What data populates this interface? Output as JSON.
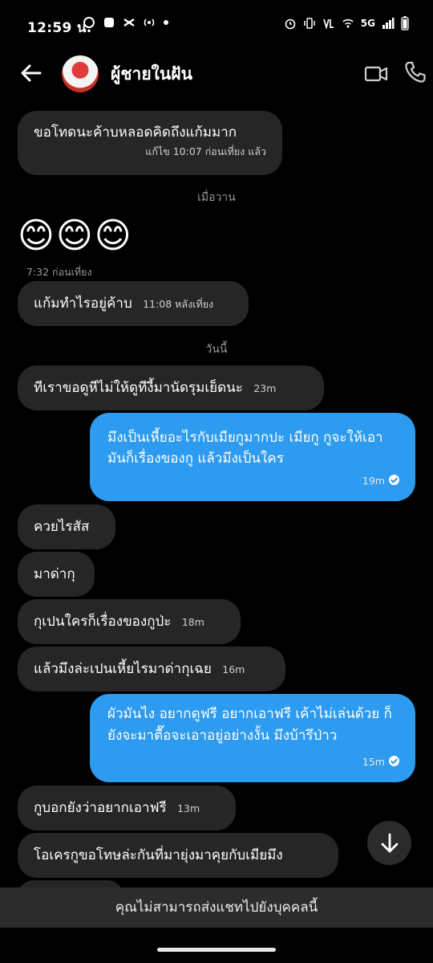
{
  "status_bar": {
    "time": "12:59 น.",
    "network": "5G"
  },
  "header": {
    "contact_name": "ผู้ชายในฝัน"
  },
  "separators": {
    "yesterday": "เมื่อวาน",
    "today": "วันนี้"
  },
  "messages": [
    {
      "dir": "in",
      "text": "ขอโทดนะค้าบหลอดคิดถึงแก้มมาก",
      "meta": "แก้ไข 10:07 ก่อนเที่ยง แล้ว"
    },
    {
      "dir": "in",
      "text": "😊😊😊",
      "meta": "7:32 ก่อนเที่ยง"
    },
    {
      "dir": "in",
      "text": "แก้มทำไรอยู่ค้าบ",
      "meta": "11:08 หลังเที่ยง"
    },
    {
      "dir": "in",
      "text": "ทีเราขอดูหีไม่ให้ดูทีงี้มานัดรุมเย็ดนะ",
      "meta": "23m"
    },
    {
      "dir": "out",
      "text": "มึงเป็นเหี้ยอะไรกับเมียกูมากปะ เมียกู กูจะให้เอามันก็เรื่องของกู แล้วมึงเป็นใคร",
      "meta": "19m"
    },
    {
      "dir": "in",
      "text": "ควยไรสัส",
      "meta": ""
    },
    {
      "dir": "in",
      "text": "มาด่ากุ",
      "meta": ""
    },
    {
      "dir": "in",
      "text": "กุเปนใครก็เรื่องของกูป่ะ",
      "meta": "18m"
    },
    {
      "dir": "in",
      "text": "แล้วมึงล่ะเปนเหี้ยไรมาด่ากุเฉย",
      "meta": "16m"
    },
    {
      "dir": "out",
      "text": "ผัวมันไง อยากดูฟรี อยากเอาฟรี เค้าไม่เล่นด้วย ก็ยังจะมาตื๊อจะเอาอยู่อย่างงั้น มึงบ้ารึป่าว",
      "meta": "15m"
    },
    {
      "dir": "in",
      "text": "กูบอกยังว่าอยากเอาฟรี",
      "meta": "13m"
    },
    {
      "dir": "in",
      "text": "โอเครกูขอโทษล่ะกันที่มายุ่งมาคุยกับเมียมึง",
      "meta": ""
    }
  ],
  "bottom_notice": "คุณไม่สามารถส่งแชทไปยังบุคคลนี้",
  "icons": [
    "arrow-left-icon",
    "video-call-icon",
    "phone-icon",
    "arrow-down-icon"
  ],
  "colors": {
    "outgoing": "#2d9bef",
    "incoming": "#262626",
    "background": "#000000"
  }
}
